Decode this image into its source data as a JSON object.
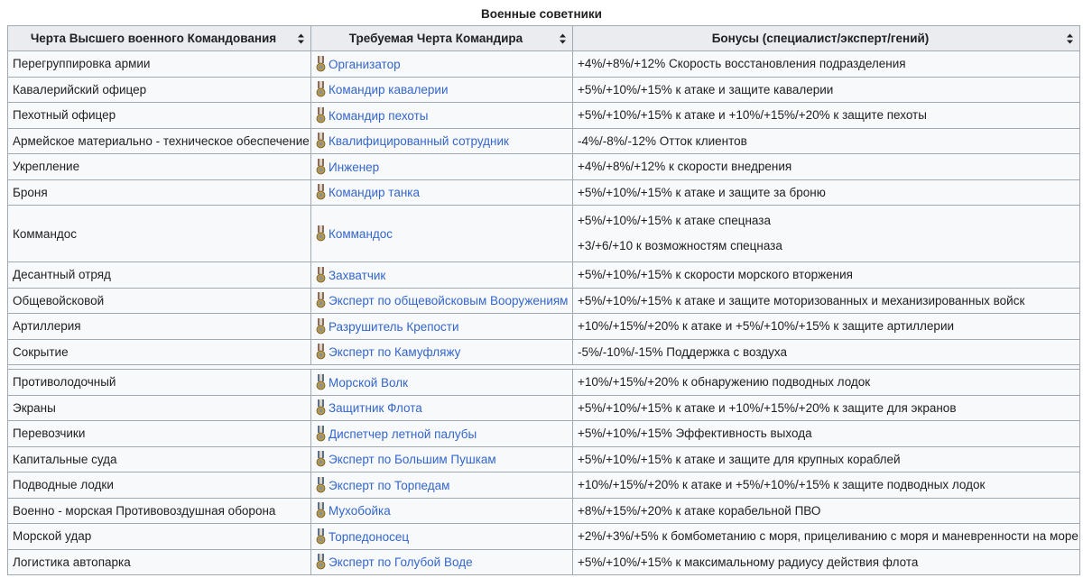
{
  "caption": "Военные советники",
  "headers": [
    "Черта Высшего военного Командования",
    "Требуемая Черта Командира",
    "Бонусы (специалист/эксперт/гений)"
  ],
  "groups": [
    [
      {
        "trait": "Перегруппировка армии",
        "commander": "Организатор",
        "bonus": [
          "+4%/+8%/+12% Скорость восстановления подразделения"
        ]
      },
      {
        "trait": "Кавалерийский офицер",
        "commander": "Командир кавалерии",
        "bonus": [
          "+5%/+10%/+15% к атаке и защите кавалерии"
        ]
      },
      {
        "trait": "Пехотный офицер",
        "commander": "Командир пехоты",
        "bonus": [
          "+5%/+10%/+15% к атаке и +10%/+15%/+20% к защите пехоты"
        ]
      },
      {
        "trait": "Армейское материально - техническое обеспечение",
        "commander": "Квалифицированный сотрудник",
        "bonus": [
          "-4%/-8%/-12% Отток клиентов"
        ]
      },
      {
        "trait": "Укрепление",
        "commander": "Инженер",
        "bonus": [
          "+4%/+8%/+12% к скорости внедрения"
        ]
      },
      {
        "trait": "Броня",
        "commander": "Командир танка",
        "bonus": [
          "+5%/+10%/+15% к атаке и защите за броню"
        ]
      },
      {
        "trait": "Коммандос",
        "commander": "Коммандос",
        "bonus": [
          "+5%/+10%/+15% к атаке спецназа",
          "+3/+6/+10 к возможностям спецназа"
        ]
      },
      {
        "trait": "Десантный отряд",
        "commander": "Захватчик",
        "bonus": [
          "+5%/+10%/+15% к скорости морского вторжения"
        ]
      },
      {
        "trait": "Общевойсковой",
        "commander": "Эксперт по общевойсковым Вооружениям",
        "bonus": [
          "+5%/+10%/+15% к атаке и защите моторизованных и механизированных войск"
        ]
      },
      {
        "trait": "Артиллерия",
        "commander": "Разрушитель Крепости",
        "bonus": [
          "+10%/+15%/+20% к атаке и +5%/+10%/+15% к защите артиллерии"
        ]
      },
      {
        "trait": "Сокрытие",
        "commander": "Эксперт по Камуфляжу",
        "bonus": [
          "-5%/-10%/-15% Поддержка с воздуха"
        ]
      }
    ],
    [
      {
        "trait": "Противолодочный",
        "commander": "Морской Волк",
        "bonus": [
          "+10%/+15%/+20% к обнаружению подводных лодок"
        ]
      },
      {
        "trait": "Экраны",
        "commander": "Защитник Флота",
        "bonus": [
          "+5%/+10%/+15% к атаке и +10%/+15%/+20% к защите для экранов"
        ]
      },
      {
        "trait": "Перевозчики",
        "commander": "Диспетчер летной палубы",
        "bonus": [
          "+5%/+10%/+15% Эффективность выхода"
        ]
      },
      {
        "trait": "Капитальные суда",
        "commander": "Эксперт по Большим Пушкам",
        "bonus": [
          "+5%/+10%/+15% к атаке и защите для крупных кораблей"
        ]
      },
      {
        "trait": "Подводные лодки",
        "commander": "Эксперт по Торпедам",
        "bonus": [
          "+10%/+15%/+20% к атаке и +5%/+10%/+15% к защите подводных лодок"
        ]
      },
      {
        "trait": "Военно - морская Противовоздушная оборона",
        "commander": "Мухобойка",
        "bonus": [
          "+8%/+15%/+20% к атаке корабельной ПВО"
        ]
      },
      {
        "trait": "Морской удар",
        "commander": "Торпедоносец",
        "bonus": [
          "+2%/+3%/+5% к бомбометанию с моря, прицеливанию с моря и маневренности на море"
        ]
      },
      {
        "trait": "Логистика автопарка",
        "commander": "Эксперт по Голубой Воде",
        "bonus": [
          "+5%/+10%/+15% к максимальному радиусу действия флота"
        ]
      }
    ]
  ],
  "medal_colors": {
    "army_ribbon": "#8a6b5a",
    "navy_ribbon": "#5a6f8a",
    "medal_gold": "#b89a4a",
    "medal_silver": "#8a8f96"
  },
  "link_color": "#3366cc",
  "icons": {
    "sort": "sort-arrows-icon",
    "medal": "medal-icon"
  }
}
